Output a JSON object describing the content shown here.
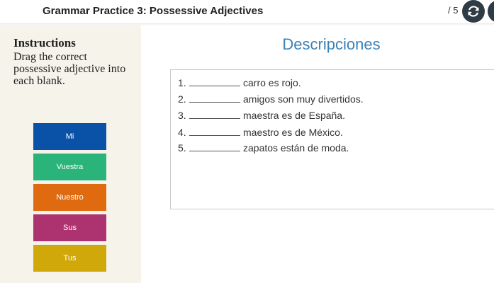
{
  "header": {
    "title": "Grammar Practice 3: Possessive Adjectives",
    "score": "/ 5"
  },
  "sidebar": {
    "instructions_title": "Instructions",
    "instructions_text": "Drag the correct possessive adjective into each blank.",
    "tiles": [
      {
        "label": "Mi",
        "color": "#0a52a8"
      },
      {
        "label": "Vuestra",
        "color": "#2ab47a"
      },
      {
        "label": "Nuestro",
        "color": "#e06a10"
      },
      {
        "label": "Sus",
        "color": "#ad3270"
      },
      {
        "label": "Tus",
        "color": "#d0a80a"
      }
    ]
  },
  "main": {
    "title": "Descripciones",
    "sentences": [
      {
        "number": "1.",
        "text": "carro es rojo."
      },
      {
        "number": "2.",
        "text": "amigos son muy divertidos."
      },
      {
        "number": "3.",
        "text": "maestra es de España."
      },
      {
        "number": "4.",
        "text": "maestro es de México."
      },
      {
        "number": "5.",
        "text": "zapatos están de moda."
      }
    ]
  },
  "icons": {
    "reset": "reset-icon",
    "next": "chevron-right-icon"
  }
}
